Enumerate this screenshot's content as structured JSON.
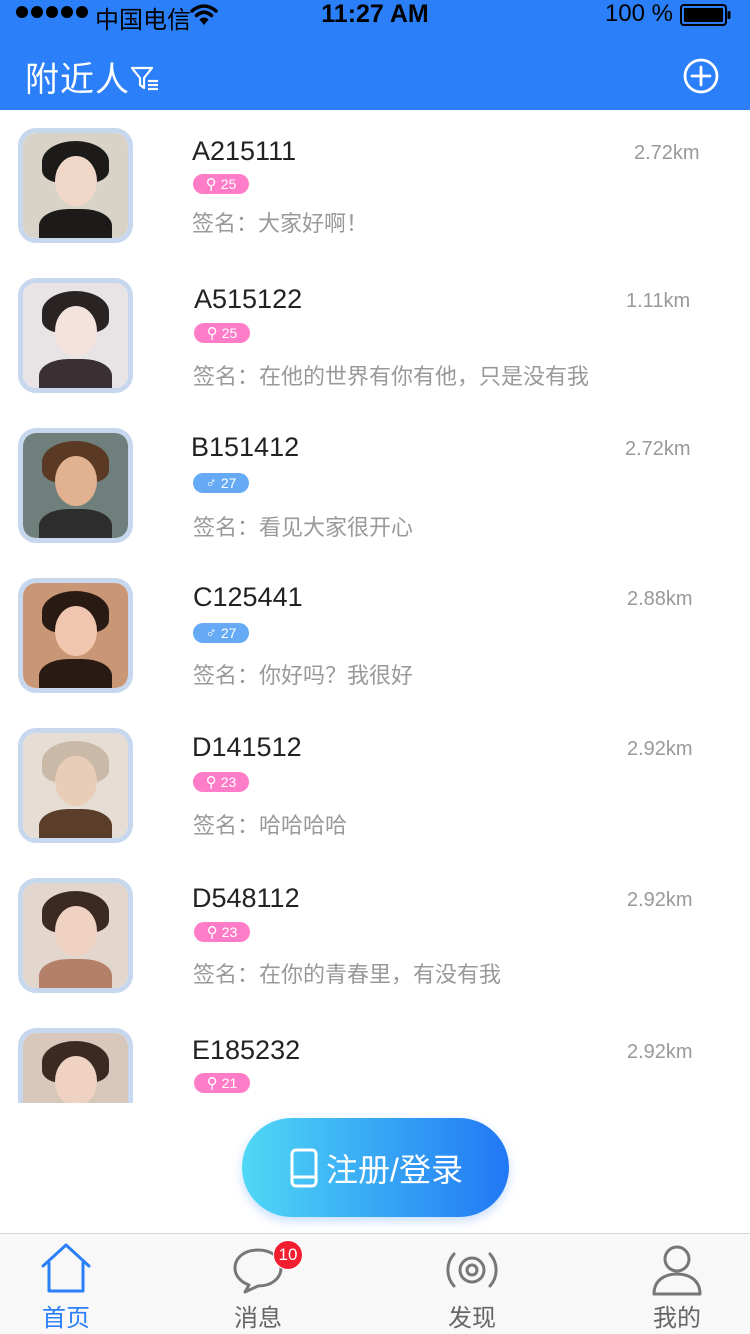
{
  "status_bar": {
    "carrier": "中国电信",
    "time": "11:27 AM",
    "battery": "100 %"
  },
  "header": {
    "title": "附近人",
    "filter_icon": "filter-icon",
    "add_icon": "plus-circle-icon"
  },
  "users": [
    {
      "name": "A215111",
      "gender": "female",
      "gender_symbol": "⚲",
      "age": "25",
      "distance": "2.72km",
      "signature": "签名：大家好啊！"
    },
    {
      "name": "A515122",
      "gender": "female",
      "gender_symbol": "⚲",
      "age": "25",
      "distance": "1.11km",
      "signature": "签名：在他的世界有你有他，只是没有我"
    },
    {
      "name": "B151412",
      "gender": "male",
      "gender_symbol": "♂",
      "age": "27",
      "distance": "2.72km",
      "signature": "签名：看见大家很开心"
    },
    {
      "name": "C125441",
      "gender": "male",
      "gender_symbol": "♂",
      "age": "27",
      "distance": "2.88km",
      "signature": "签名：你好吗？我很好"
    },
    {
      "name": "D141512",
      "gender": "female",
      "gender_symbol": "⚲",
      "age": "23",
      "distance": "2.92km",
      "signature": "签名：哈哈哈哈"
    },
    {
      "name": "D548112",
      "gender": "female",
      "gender_symbol": "⚲",
      "age": "23",
      "distance": "2.92km",
      "signature": "签名：在你的青春里，有没有我"
    },
    {
      "name": "E185232",
      "gender": "female",
      "gender_symbol": "⚲",
      "age": "21",
      "distance": "2.92km",
      "signature": ""
    }
  ],
  "login_button": {
    "label": "注册/登录",
    "icon": "phone-icon"
  },
  "tabbar": {
    "tabs": [
      {
        "label": "首页",
        "icon": "home-icon",
        "active": true
      },
      {
        "label": "消息",
        "icon": "chat-bubble-icon",
        "badge": "10"
      },
      {
        "label": "发现",
        "icon": "radio-signal-icon"
      },
      {
        "label": "我的",
        "icon": "user-icon"
      }
    ]
  },
  "colors": {
    "primary": "#2b7ff9",
    "female_badge": "#ff7dc8",
    "male_badge": "#66a9f5",
    "unread_badge": "#f21d2f",
    "gradient_start": "#4fd8f5",
    "gradient_end": "#2178f5"
  }
}
